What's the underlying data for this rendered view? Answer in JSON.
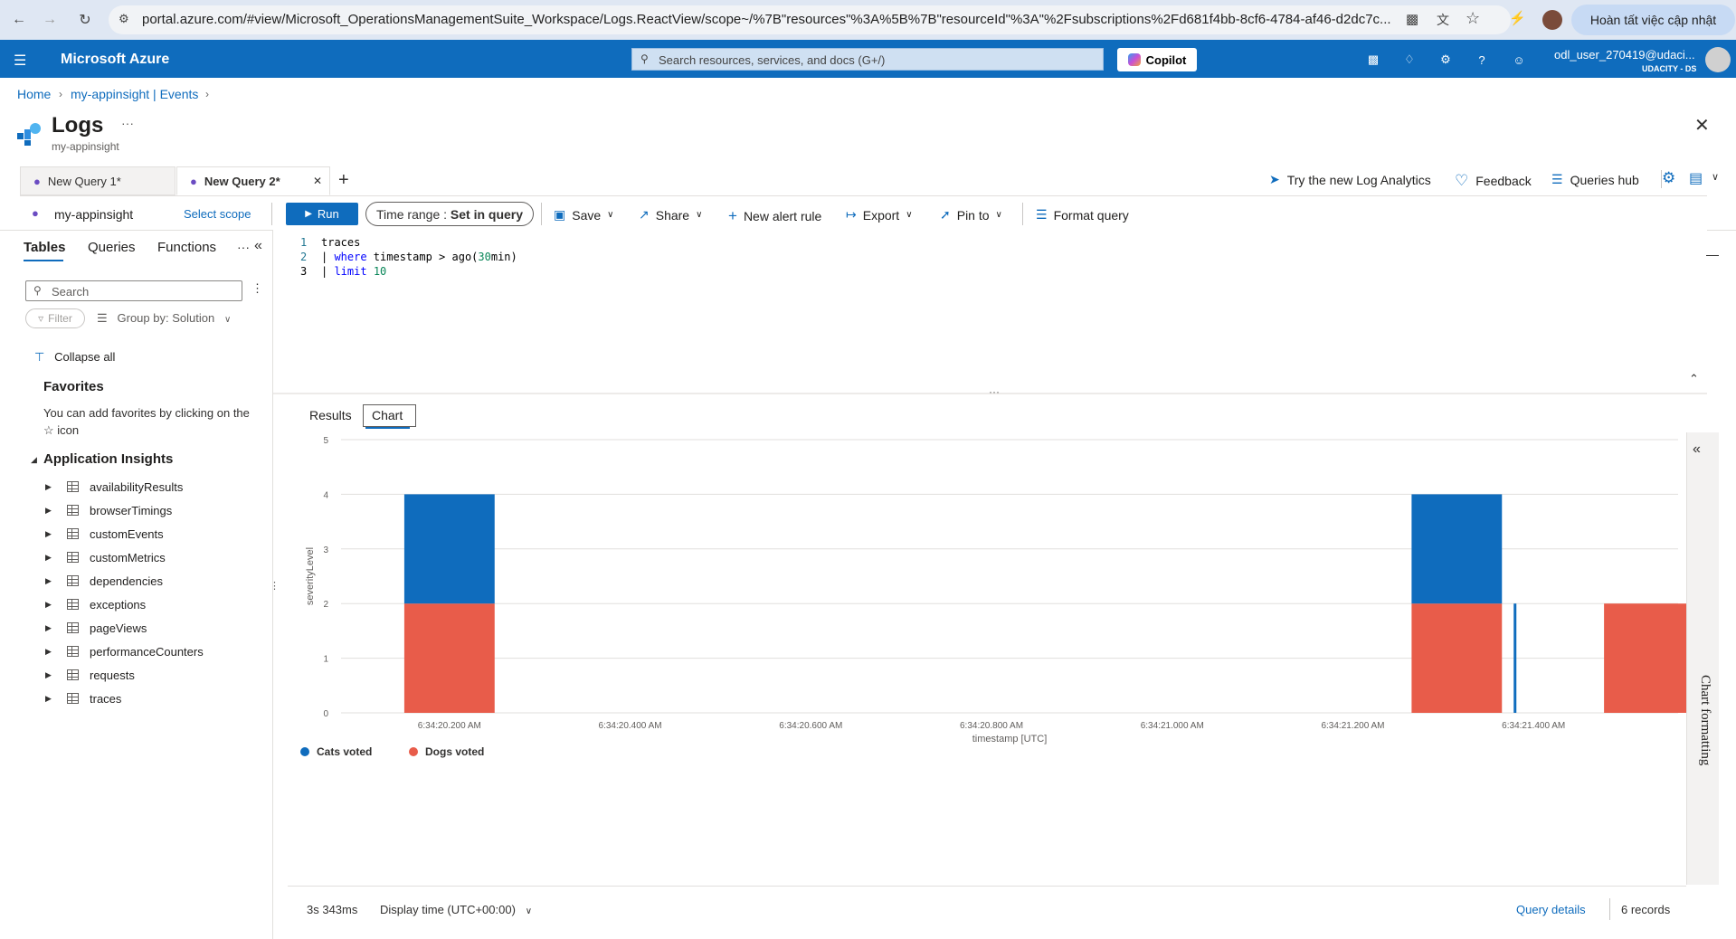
{
  "browser": {
    "url": "portal.azure.com/#view/Microsoft_OperationsManagementSuite_Workspace/Logs.ReactView/scope~/%7B\"resources\"%3A%5B%7B\"resourceId\"%3A\"%2Fsubscriptions%2Fd681f4bb-8cf6-4784-af46-d2dc7c...",
    "update_label": "Hoàn tất việc cập nhật"
  },
  "azure": {
    "brand": "Microsoft Azure",
    "search_placeholder": "Search resources, services, and docs (G+/)",
    "copilot_label": "Copilot",
    "user_name": "odl_user_270419@udaci...",
    "user_org": "UDACITY - DS"
  },
  "breadcrumb": {
    "home": "Home",
    "parent": "my-appinsight | Events"
  },
  "page": {
    "title": "Logs",
    "subtitle": "my-appinsight",
    "more": "···"
  },
  "query_tabs": [
    {
      "label": "New Query 1*"
    },
    {
      "label": "New Query 2*"
    }
  ],
  "right_tools": {
    "try_new": "Try the new Log Analytics",
    "feedback": "Feedback",
    "queries_hub": "Queries hub"
  },
  "toolbar": {
    "scope_name": "my-appinsight",
    "select_scope": "Select scope",
    "run": "Run",
    "time_range_label": "Time range :",
    "time_range_value": "Set in query",
    "save": "Save",
    "share": "Share",
    "new_alert": "New alert rule",
    "export": "Export",
    "pin_to": "Pin to",
    "format_query": "Format query"
  },
  "left_pane": {
    "tabs": [
      "Tables",
      "Queries",
      "Functions"
    ],
    "search_placeholder": "Search",
    "filter": "Filter",
    "group_by": "Group by: Solution",
    "collapse_all": "Collapse all",
    "favorites_title": "Favorites",
    "favorites_text": "You can add favorites by clicking on the ☆ icon",
    "section_title": "Application Insights",
    "tables": [
      "availabilityResults",
      "browserTimings",
      "customEvents",
      "customMetrics",
      "dependencies",
      "exceptions",
      "pageViews",
      "performanceCounters",
      "requests",
      "traces"
    ]
  },
  "editor": {
    "lines": [
      {
        "n": "1",
        "text": "traces"
      },
      {
        "n": "2",
        "text": "| where timestamp > ago(30min)"
      },
      {
        "n": "3",
        "text": "| limit 10"
      }
    ]
  },
  "results_tabs": {
    "results": "Results",
    "chart": "Chart"
  },
  "chart_data": {
    "type": "bar",
    "stacked": true,
    "xlabel": "timestamp [UTC]",
    "ylabel": "severityLevel",
    "ylim": [
      0,
      5
    ],
    "yticks": [
      "0",
      "1",
      "2",
      "3",
      "4",
      "5"
    ],
    "x_ticks": [
      "6:34:20.200 AM",
      "6:34:20.400 AM",
      "6:34:20.600 AM",
      "6:34:20.800 AM",
      "6:34:21.000 AM",
      "6:34:21.200 AM",
      "6:34:21.400 AM"
    ],
    "x_ms_range": [
      20080,
      21560
    ],
    "x_tick_ms": [
      20200,
      20400,
      20600,
      20800,
      21000,
      21200,
      21400
    ],
    "bars": [
      {
        "x_ms": 20150,
        "width_ms": 100,
        "series": "Dogs voted",
        "base": 0,
        "value": 2
      },
      {
        "x_ms": 20150,
        "width_ms": 100,
        "series": "Cats voted",
        "base": 2,
        "value": 2
      },
      {
        "x_ms": 21265,
        "width_ms": 100,
        "series": "Dogs voted",
        "base": 0,
        "value": 2
      },
      {
        "x_ms": 21265,
        "width_ms": 100,
        "series": "Cats voted",
        "base": 2,
        "value": 2
      },
      {
        "x_ms": 21378,
        "width_ms": 3,
        "series": "Cats voted",
        "base": 0,
        "value": 2
      },
      {
        "x_ms": 21478,
        "width_ms": 100,
        "series": "Dogs voted",
        "base": 0,
        "value": 2
      }
    ],
    "series": [
      {
        "name": "Cats voted",
        "color": "#0f6cbd"
      },
      {
        "name": "Dogs voted",
        "color": "#e85c4a"
      }
    ],
    "legend_position": "bottom-left",
    "grid": true
  },
  "chart_formatting_label": "Chart formatting",
  "footer": {
    "duration": "3s 343ms",
    "display_time": "Display time (UTC+00:00)",
    "query_details": "Query details",
    "records": "6 records"
  }
}
